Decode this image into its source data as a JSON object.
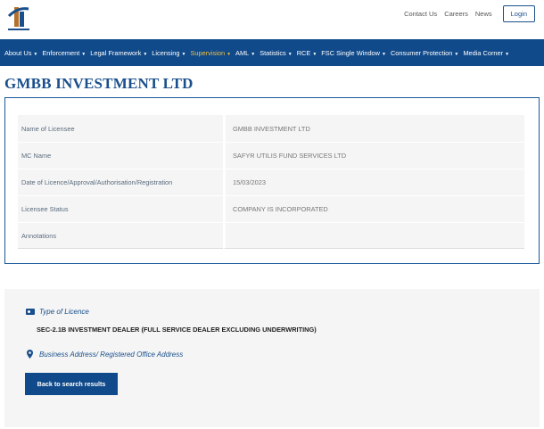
{
  "header": {
    "top_links": [
      "Contact Us",
      "Careers",
      "News"
    ],
    "login_label": "Login"
  },
  "nav": {
    "items": [
      {
        "label": "About Us",
        "active": false
      },
      {
        "label": "Enforcement",
        "active": false
      },
      {
        "label": "Legal Framework",
        "active": false
      },
      {
        "label": "Licensing",
        "active": false
      },
      {
        "label": "Supervision",
        "active": true
      },
      {
        "label": "AML",
        "active": false
      },
      {
        "label": "Statistics",
        "active": false
      },
      {
        "label": "RCE",
        "active": false
      },
      {
        "label": "FSC Single Window",
        "active": false
      },
      {
        "label": "Consumer Protection",
        "active": false
      },
      {
        "label": "Media Corner",
        "active": false
      }
    ]
  },
  "page": {
    "title": "GMBB INVESTMENT LTD"
  },
  "details": {
    "rows": [
      {
        "key": "Name of Licensee",
        "value": "GMBB INVESTMENT LTD"
      },
      {
        "key": "MC Name",
        "value": "SAFYR UTILIS FUND SERVICES LTD"
      },
      {
        "key": "Date of Licence/Approval/Authorisation/Registration",
        "value": "15/03/2023"
      },
      {
        "key": "Licensee Status",
        "value": "COMPANY IS INCORPORATED"
      },
      {
        "key": "Annotations",
        "value": ""
      }
    ]
  },
  "licence": {
    "type_label": "Type of Licence",
    "type_value": "SEC-2.1B INVESTMENT DEALER (FULL SERVICE DEALER EXCLUDING UNDERWRITING)",
    "address_label": "Business Address/ Registered Office Address",
    "back_label": "Back to search results"
  },
  "colors": {
    "brand_blue": "#114a8a",
    "nav_active": "#f0c040",
    "panel_bg": "#f5f5f5"
  },
  "icons": [
    "logo",
    "id-card-icon",
    "map-pin-icon",
    "caret-down-icon"
  ]
}
